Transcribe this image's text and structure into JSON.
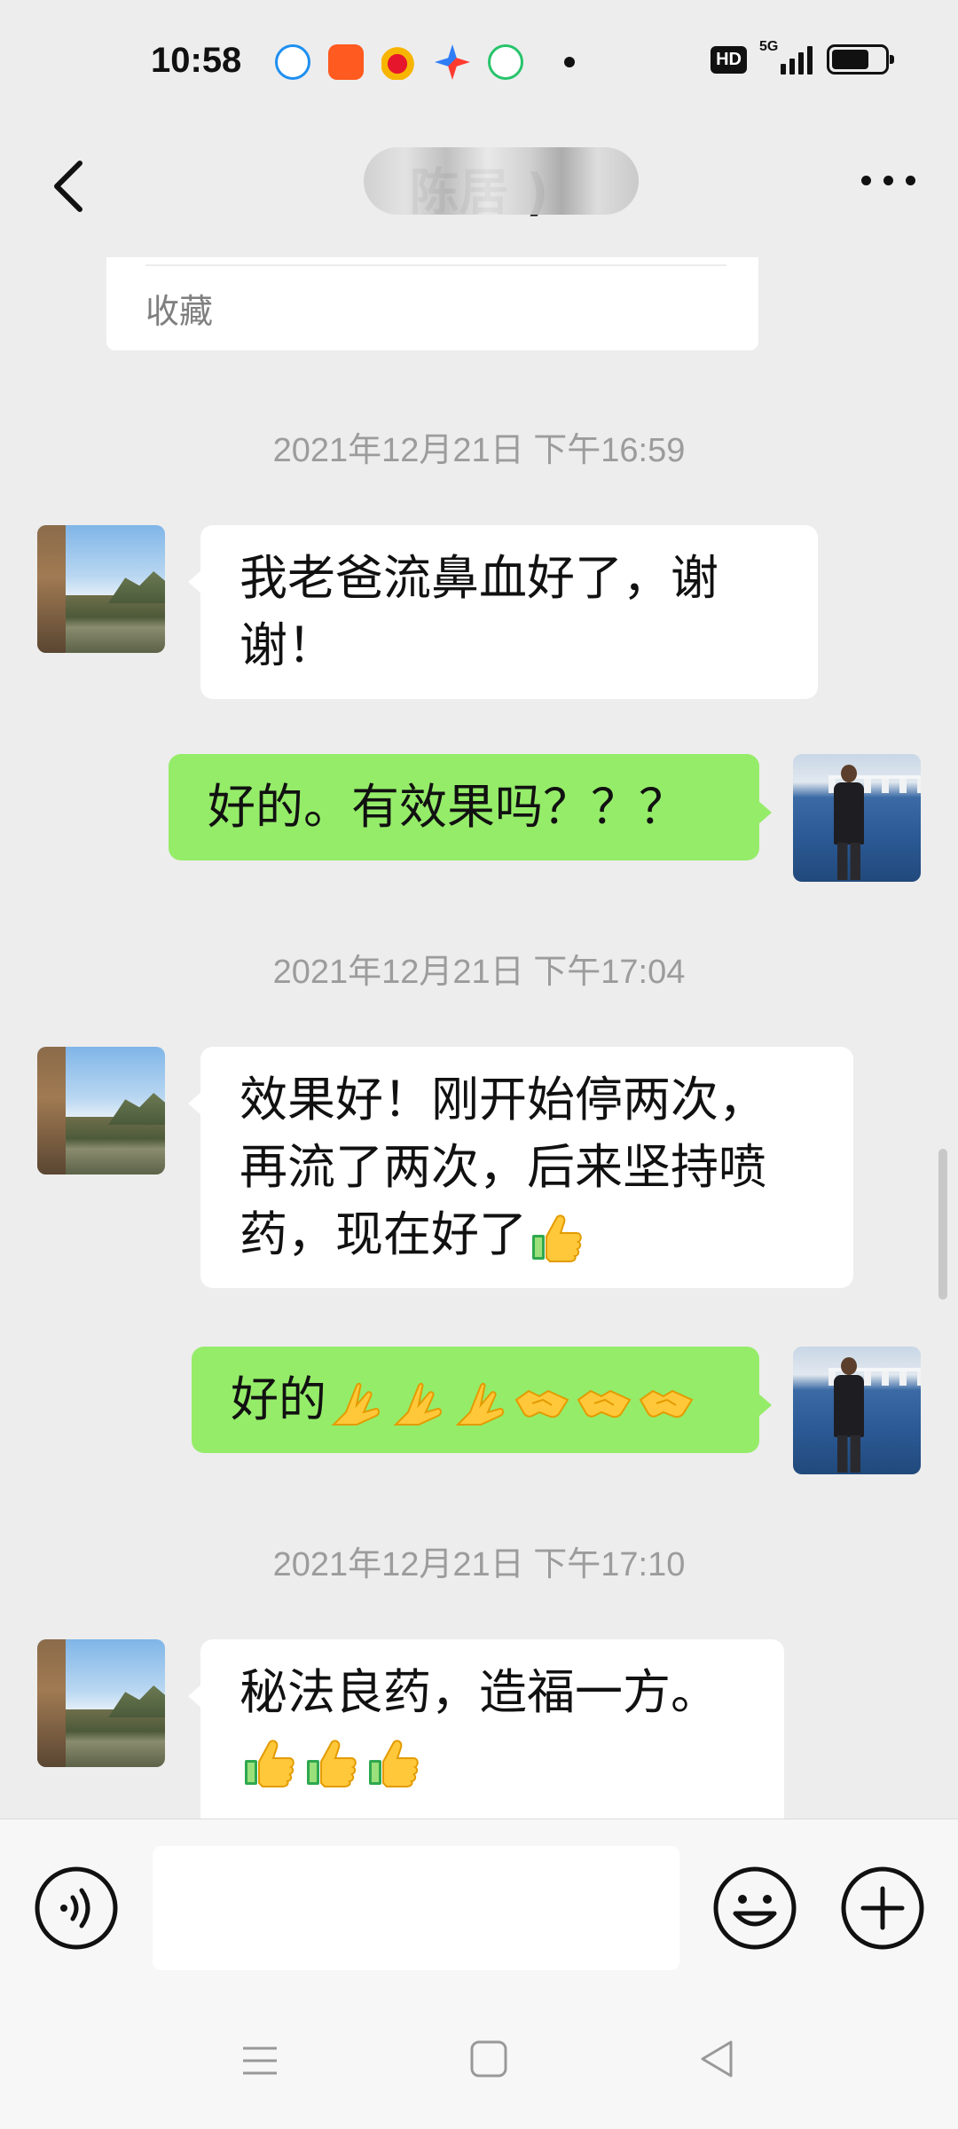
{
  "status_bar": {
    "time": "10:58",
    "notification_icons": [
      "browser-icon",
      "kuaishou-icon",
      "weibo-icon",
      "compass-icon",
      "video-icon"
    ],
    "hd_label": "HD",
    "network_label": "5G",
    "battery_level": 0.7
  },
  "header": {
    "title": "陈居                )"
  },
  "favorites_card": {
    "label": "收藏"
  },
  "timestamps": {
    "t1": "2021年12月21日 下午16:59",
    "t2": "2021年12月21日 下午17:04",
    "t3": "2021年12月21日 下午17:10"
  },
  "messages": {
    "m1": {
      "line1": "我老爸流鼻血好了，谢",
      "line2": "谢！"
    },
    "m2": {
      "text": "好的。有效果吗？？？"
    },
    "m3": {
      "line1": "效果好！刚开始停两次，",
      "line2": "再流了两次，后来坚持喷",
      "line3": "药，现在好了"
    },
    "m4": {
      "text": "好的"
    },
    "m5": {
      "line1": "秘法良药，造福一方。"
    }
  },
  "input": {
    "placeholder": ""
  },
  "colors": {
    "background": "#ededed",
    "sent_bubble": "#95ec69",
    "received_bubble": "#ffffff",
    "timestamp_text": "#9c9c9c"
  }
}
